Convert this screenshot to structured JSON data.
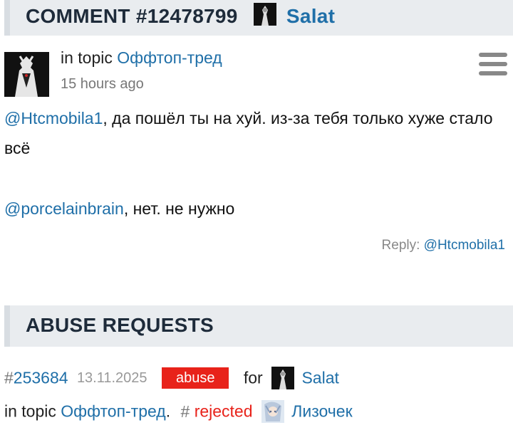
{
  "comment_header": {
    "prefix": "COMMENT #12478799",
    "author": "Salat",
    "author_avatar_icon": "dark-figure-avatar"
  },
  "comment": {
    "avatar_icon": "dark-figure-avatar",
    "topic_prefix": "in topic",
    "topic_link": "Оффтоп-тред",
    "time_ago": "15 hours ago",
    "menu_icon": "hamburger-menu-icon",
    "paragraph1_mention": "@Htcmobila1",
    "paragraph1_text": ", да пошёл ты на хуй. из-за тебя только хуже стало всё",
    "paragraph2_mention": "@porcelainbrain",
    "paragraph2_text": ", нет. не нужно",
    "reply_label": "Reply:",
    "reply_target": "@Htcmobila1"
  },
  "abuse_header": {
    "title": "ABUSE REQUESTS"
  },
  "abuse_request": {
    "hash": "#",
    "id": "253684",
    "date": "13.11.2025",
    "badge": "abuse",
    "for_label": "for",
    "target_user": "Salat",
    "target_avatar_icon": "dark-figure-avatar",
    "topic_prefix": "in topic",
    "topic_link": "Оффтоп-тред",
    "topic_suffix": ".",
    "status_hash": "#",
    "status": "rejected",
    "moderator_avatar_icon": "anime-girl-avatar",
    "moderator": "Лизочек"
  },
  "colors": {
    "link": "#1f6fa8",
    "header_bg": "#e9ecef",
    "abuse_badge": "#e8221a",
    "rejected": "#e8221a"
  }
}
